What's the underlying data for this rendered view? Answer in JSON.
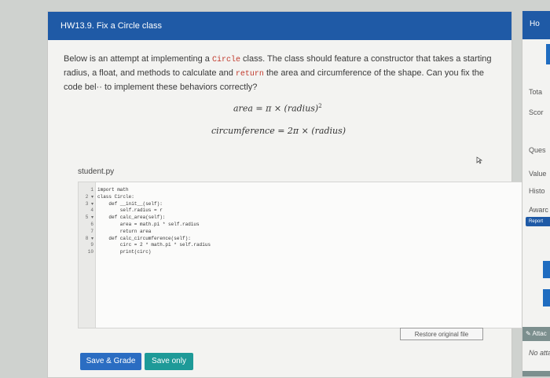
{
  "main": {
    "title": "HW13.9. Fix a Circle class",
    "intro_part1": "Below is an attempt at implementing a ",
    "intro_code1": "Circle",
    "intro_part2": " class. The class should feature a constructor that takes a starting radius, a float, and methods to calculate and ",
    "intro_code2": "return",
    "intro_part3": " the area and circumference of the shape. Can you fix the code bel·· to implement these behaviors correctly?",
    "formula_area_left": "area = π × (radius)",
    "formula_area_exp": "2",
    "formula_circ": "circumference = 2π × (radius)"
  },
  "editor": {
    "filename": "student.py",
    "lines": [
      {
        "n": "1",
        "code": "import math"
      },
      {
        "n": "2 ▾",
        "code": "class Circle:"
      },
      {
        "n": "3 ▾",
        "code": "    def __init__(self):"
      },
      {
        "n": "4",
        "code": "        self.radius = r"
      },
      {
        "n": "5 ▾",
        "code": "    def calc_area(self):"
      },
      {
        "n": "6",
        "code": "        area = math.pi * self.radius"
      },
      {
        "n": "7",
        "code": "        return area"
      },
      {
        "n": "8 ▾",
        "code": "    def calc_circumference(self):"
      },
      {
        "n": "9",
        "code": "        circ = 2 * math.pi * self.radius"
      },
      {
        "n": "10",
        "code": "        print(circ)"
      }
    ],
    "restore_label": "Restore original file"
  },
  "actions": {
    "save_grade": "Save & Grade",
    "save_only": "Save only"
  },
  "side": {
    "header": "Ho",
    "total": "Tota",
    "score": "Scor",
    "question": "Ques",
    "value": "Value",
    "history": "Histo",
    "award": "Awarc",
    "report": "Report",
    "attach": "Attac",
    "no_attach": "No attac"
  }
}
